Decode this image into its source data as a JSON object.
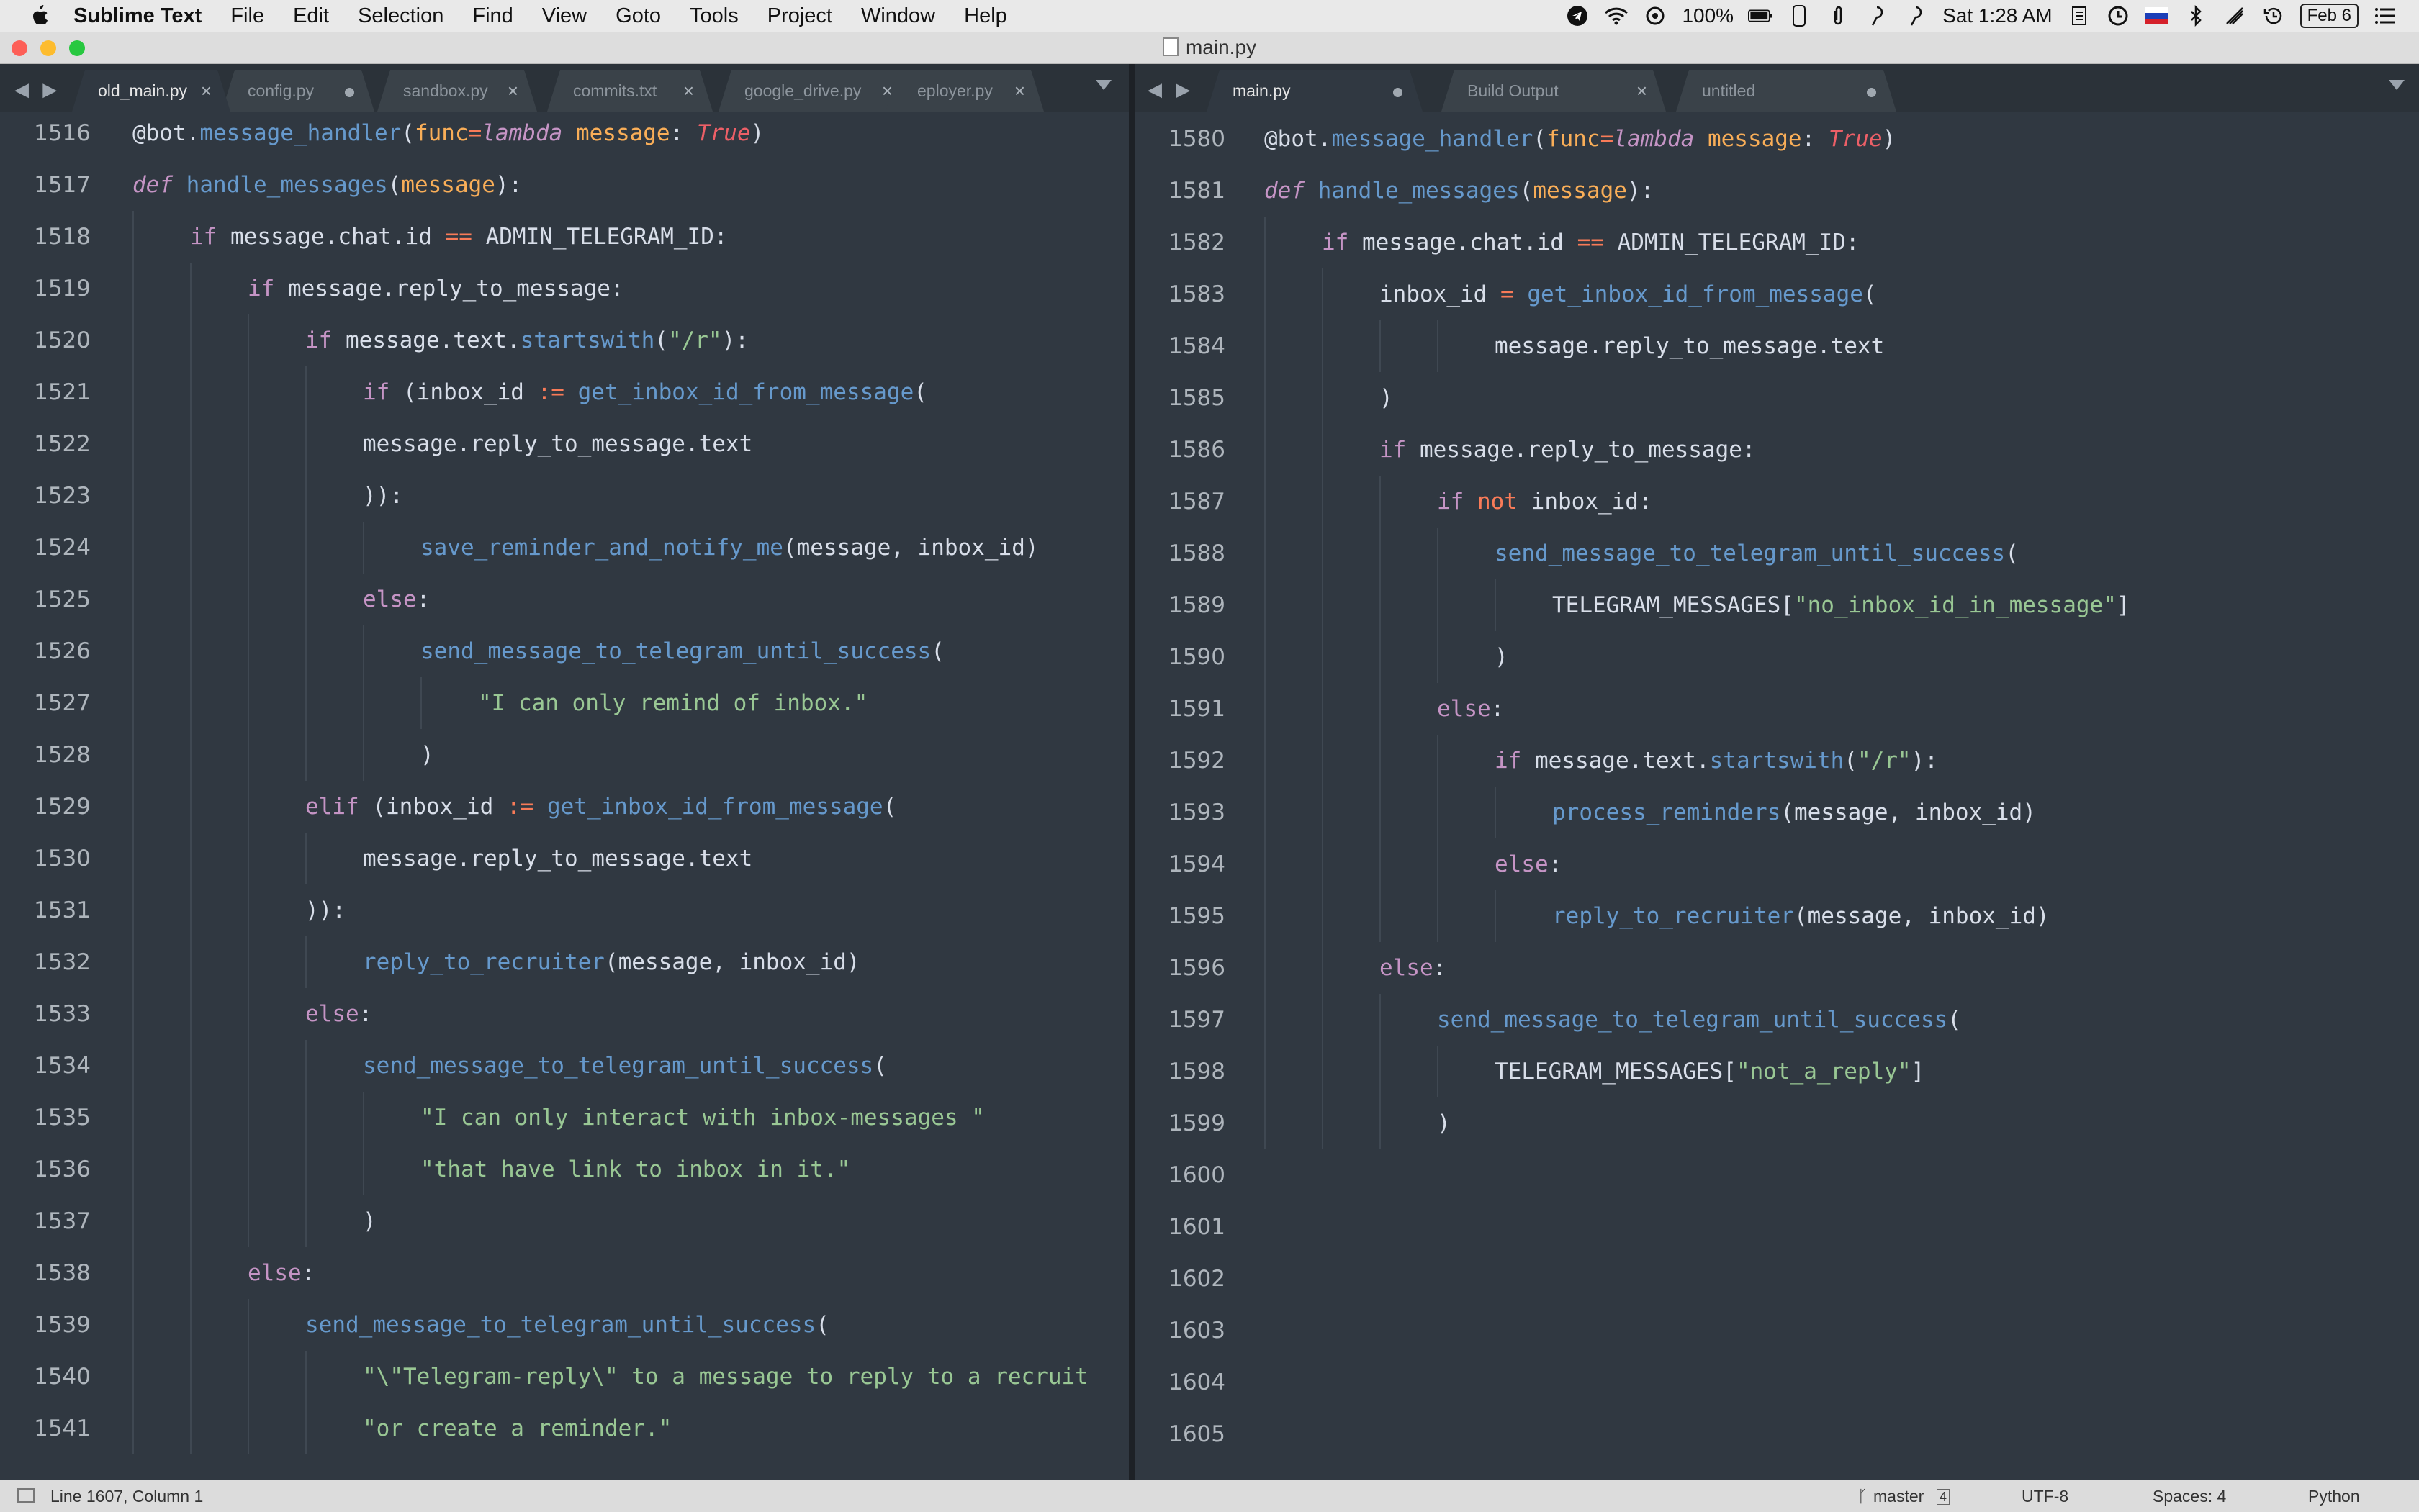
{
  "menubar": {
    "app": "Sublime Text",
    "items": [
      "File",
      "Edit",
      "Selection",
      "Find",
      "View",
      "Goto",
      "Tools",
      "Project",
      "Window",
      "Help"
    ],
    "battery": "100%",
    "clock": "Sat 1:28 AM",
    "date_badge": "Feb 6"
  },
  "window": {
    "title": "main.py"
  },
  "left_pane": {
    "tabs": [
      {
        "label": "old_main.py",
        "active": true,
        "marker": "close"
      },
      {
        "label": "config.py",
        "active": false,
        "marker": "dot"
      },
      {
        "label": "sandbox.py",
        "active": false,
        "marker": "close"
      },
      {
        "label": "commits.txt",
        "active": false,
        "marker": "close"
      },
      {
        "label": "google_drive.py",
        "active": false,
        "marker": "close"
      },
      {
        "label": "eployer.py",
        "active": false,
        "marker": "close"
      }
    ],
    "lines": [
      {
        "n": "1516",
        "indent": 0,
        "tokens": [
          [
            "pl",
            "@bot."
          ],
          [
            "fn",
            "message_handler"
          ],
          [
            "pl",
            "("
          ],
          [
            "param",
            "func"
          ],
          [
            "op",
            "="
          ],
          [
            "k",
            "lambda"
          ],
          [
            "pl",
            " "
          ],
          [
            "param",
            "message"
          ],
          [
            "pl",
            ": "
          ],
          [
            "bool",
            "True"
          ],
          [
            "pl",
            ")"
          ]
        ]
      },
      {
        "n": "1517",
        "indent": 0,
        "tokens": [
          [
            "k",
            "def"
          ],
          [
            "pl",
            " "
          ],
          [
            "fn",
            "handle_messages"
          ],
          [
            "pl",
            "("
          ],
          [
            "param",
            "message"
          ],
          [
            "pl",
            "):"
          ]
        ]
      },
      {
        "n": "1518",
        "indent": 1,
        "tokens": [
          [
            "k2",
            "if"
          ],
          [
            "pl",
            " message.chat.id "
          ],
          [
            "op",
            "=="
          ],
          [
            "pl",
            " ADMIN_TELEGRAM_ID:"
          ]
        ]
      },
      {
        "n": "1519",
        "indent": 2,
        "tokens": [
          [
            "k2",
            "if"
          ],
          [
            "pl",
            " message.reply_to_message:"
          ]
        ]
      },
      {
        "n": "1520",
        "indent": 3,
        "tokens": [
          [
            "k2",
            "if"
          ],
          [
            "pl",
            " message.text."
          ],
          [
            "fn",
            "startswith"
          ],
          [
            "pl",
            "("
          ],
          [
            "str",
            "\"/r\""
          ],
          [
            "pl",
            "):"
          ]
        ]
      },
      {
        "n": "1521",
        "indent": 4,
        "tokens": [
          [
            "k2",
            "if"
          ],
          [
            "pl",
            " (inbox_id "
          ],
          [
            "op",
            ":="
          ],
          [
            "pl",
            " "
          ],
          [
            "fn",
            "get_inbox_id_from_message"
          ],
          [
            "pl",
            "("
          ]
        ]
      },
      {
        "n": "1522",
        "indent": 4,
        "tokens": [
          [
            "pl",
            "message.reply_to_message.text"
          ]
        ]
      },
      {
        "n": "1523",
        "indent": 4,
        "tokens": [
          [
            "pl",
            "))"
          ],
          [
            "pl",
            ":"
          ]
        ]
      },
      {
        "n": "1524",
        "indent": 5,
        "tokens": [
          [
            "fn",
            "save_reminder_and_notify_me"
          ],
          [
            "pl",
            "(message, inbox_id)"
          ]
        ]
      },
      {
        "n": "1525",
        "indent": 4,
        "tokens": [
          [
            "k2",
            "else"
          ],
          [
            "pl",
            ":"
          ]
        ]
      },
      {
        "n": "1526",
        "indent": 5,
        "tokens": [
          [
            "fn",
            "send_message_to_telegram_until_success"
          ],
          [
            "pl",
            "("
          ]
        ]
      },
      {
        "n": "1527",
        "indent": 6,
        "tokens": [
          [
            "str",
            "\"I can only remind of inbox.\""
          ]
        ]
      },
      {
        "n": "1528",
        "indent": 5,
        "tokens": [
          [
            "pl",
            ")"
          ]
        ]
      },
      {
        "n": "1529",
        "indent": 3,
        "tokens": [
          [
            "k2",
            "elif"
          ],
          [
            "pl",
            " (inbox_id "
          ],
          [
            "op",
            ":="
          ],
          [
            "pl",
            " "
          ],
          [
            "fn",
            "get_inbox_id_from_message"
          ],
          [
            "pl",
            "("
          ]
        ]
      },
      {
        "n": "1530",
        "indent": 4,
        "tokens": [
          [
            "pl",
            "message.reply_to_message.text"
          ]
        ]
      },
      {
        "n": "1531",
        "indent": 3,
        "tokens": [
          [
            "pl",
            "))"
          ],
          [
            "pl",
            ":"
          ]
        ]
      },
      {
        "n": "1532",
        "indent": 4,
        "tokens": [
          [
            "fn",
            "reply_to_recruiter"
          ],
          [
            "pl",
            "(message, inbox_id)"
          ]
        ]
      },
      {
        "n": "1533",
        "indent": 3,
        "tokens": [
          [
            "k2",
            "else"
          ],
          [
            "pl",
            ":"
          ]
        ]
      },
      {
        "n": "1534",
        "indent": 4,
        "tokens": [
          [
            "fn",
            "send_message_to_telegram_until_success"
          ],
          [
            "pl",
            "("
          ]
        ]
      },
      {
        "n": "1535",
        "indent": 5,
        "tokens": [
          [
            "str",
            "\"I can only interact with inbox-messages \""
          ]
        ]
      },
      {
        "n": "1536",
        "indent": 5,
        "tokens": [
          [
            "str",
            "\"that have link to inbox in it.\""
          ]
        ]
      },
      {
        "n": "1537",
        "indent": 4,
        "tokens": [
          [
            "pl",
            ")"
          ]
        ]
      },
      {
        "n": "1538",
        "indent": 2,
        "tokens": [
          [
            "k2",
            "else"
          ],
          [
            "pl",
            ":"
          ]
        ]
      },
      {
        "n": "1539",
        "indent": 3,
        "tokens": [
          [
            "fn",
            "send_message_to_telegram_until_success"
          ],
          [
            "pl",
            "("
          ]
        ]
      },
      {
        "n": "1540",
        "indent": 4,
        "tokens": [
          [
            "str",
            "\"\\\"Telegram-reply\\\" to a message to reply to a recruit"
          ]
        ]
      },
      {
        "n": "1541",
        "indent": 4,
        "tokens": [
          [
            "str",
            "\"or create a reminder.\""
          ]
        ]
      }
    ]
  },
  "right_pane": {
    "tabs": [
      {
        "label": "main.py",
        "active": true,
        "marker": "dot"
      },
      {
        "label": "Build Output",
        "active": false,
        "marker": "close"
      },
      {
        "label": "untitled",
        "active": false,
        "marker": "dot"
      }
    ],
    "lines": [
      {
        "n": "1580",
        "indent": 0,
        "tokens": [
          [
            "pl",
            "@bot."
          ],
          [
            "fn",
            "message_handler"
          ],
          [
            "pl",
            "("
          ],
          [
            "param",
            "func"
          ],
          [
            "op",
            "="
          ],
          [
            "k",
            "lambda"
          ],
          [
            "pl",
            " "
          ],
          [
            "param",
            "message"
          ],
          [
            "pl",
            ": "
          ],
          [
            "bool",
            "True"
          ],
          [
            "pl",
            ")"
          ]
        ]
      },
      {
        "n": "1581",
        "indent": 0,
        "tokens": [
          [
            "k",
            "def"
          ],
          [
            "pl",
            " "
          ],
          [
            "fn",
            "handle_messages"
          ],
          [
            "pl",
            "("
          ],
          [
            "param",
            "message"
          ],
          [
            "pl",
            "):"
          ]
        ]
      },
      {
        "n": "1582",
        "indent": 1,
        "tokens": [
          [
            "k2",
            "if"
          ],
          [
            "pl",
            " message.chat.id "
          ],
          [
            "op",
            "=="
          ],
          [
            "pl",
            " ADMIN_TELEGRAM_ID:"
          ]
        ]
      },
      {
        "n": "1583",
        "indent": 2,
        "tokens": [
          [
            "pl",
            "inbox_id "
          ],
          [
            "op",
            "="
          ],
          [
            "pl",
            " "
          ],
          [
            "fn",
            "get_inbox_id_from_message"
          ],
          [
            "pl",
            "("
          ]
        ]
      },
      {
        "n": "1584",
        "indent": 4,
        "tokens": [
          [
            "pl",
            "message.reply_to_message.text"
          ]
        ]
      },
      {
        "n": "1585",
        "indent": 2,
        "tokens": [
          [
            "pl",
            ")"
          ]
        ]
      },
      {
        "n": "1586",
        "indent": 2,
        "tokens": [
          [
            "k2",
            "if"
          ],
          [
            "pl",
            " message.reply_to_message:"
          ]
        ]
      },
      {
        "n": "1587",
        "indent": 3,
        "tokens": [
          [
            "k2",
            "if"
          ],
          [
            "pl",
            " "
          ],
          [
            "op",
            "not"
          ],
          [
            "pl",
            " inbox_id:"
          ]
        ]
      },
      {
        "n": "1588",
        "indent": 4,
        "tokens": [
          [
            "fn",
            "send_message_to_telegram_until_success"
          ],
          [
            "pl",
            "("
          ]
        ]
      },
      {
        "n": "1589",
        "indent": 5,
        "tokens": [
          [
            "pl",
            "TELEGRAM_MESSAGES["
          ],
          [
            "str",
            "\"no_inbox_id_in_message\""
          ],
          [
            "pl",
            "]"
          ]
        ]
      },
      {
        "n": "1590",
        "indent": 4,
        "tokens": [
          [
            "pl",
            ")"
          ]
        ]
      },
      {
        "n": "1591",
        "indent": 3,
        "tokens": [
          [
            "k2",
            "else"
          ],
          [
            "pl",
            ":"
          ]
        ]
      },
      {
        "n": "1592",
        "indent": 4,
        "tokens": [
          [
            "k2",
            "if"
          ],
          [
            "pl",
            " message.text."
          ],
          [
            "fn",
            "startswith"
          ],
          [
            "pl",
            "("
          ],
          [
            "str",
            "\"/r\""
          ],
          [
            "pl",
            "):"
          ]
        ]
      },
      {
        "n": "1593",
        "indent": 5,
        "tokens": [
          [
            "fn",
            "process_reminders"
          ],
          [
            "pl",
            "(message, inbox_id)"
          ]
        ]
      },
      {
        "n": "1594",
        "indent": 4,
        "tokens": [
          [
            "k2",
            "else"
          ],
          [
            "pl",
            ":"
          ]
        ]
      },
      {
        "n": "1595",
        "indent": 5,
        "tokens": [
          [
            "fn",
            "reply_to_recruiter"
          ],
          [
            "pl",
            "(message, inbox_id)"
          ]
        ]
      },
      {
        "n": "1596",
        "indent": 2,
        "tokens": [
          [
            "k2",
            "else"
          ],
          [
            "pl",
            ":"
          ]
        ]
      },
      {
        "n": "1597",
        "indent": 3,
        "tokens": [
          [
            "fn",
            "send_message_to_telegram_until_success"
          ],
          [
            "pl",
            "("
          ]
        ]
      },
      {
        "n": "1598",
        "indent": 4,
        "tokens": [
          [
            "pl",
            "TELEGRAM_MESSAGES["
          ],
          [
            "str",
            "\"not_a_reply\""
          ],
          [
            "pl",
            "]"
          ]
        ]
      },
      {
        "n": "1599",
        "indent": 3,
        "tokens": [
          [
            "pl",
            ")"
          ]
        ]
      },
      {
        "n": "1600",
        "indent": 0,
        "tokens": []
      },
      {
        "n": "1601",
        "indent": 0,
        "tokens": []
      },
      {
        "n": "1602",
        "indent": 0,
        "tokens": []
      },
      {
        "n": "1603",
        "indent": 0,
        "tokens": []
      },
      {
        "n": "1604",
        "indent": 0,
        "tokens": []
      },
      {
        "n": "1605",
        "indent": 0,
        "tokens": []
      }
    ]
  },
  "statusbar": {
    "position": "Line 1607, Column 1",
    "branch": "master",
    "branch_count": "4",
    "encoding": "UTF-8",
    "indentation": "Spaces: 4",
    "syntax": "Python"
  },
  "colors": {
    "keyword": "#c594c5",
    "function": "#6699cc",
    "string": "#99c794",
    "operator": "#f97b58",
    "boolean": "#ec5f67",
    "parameter": "#f9ae58",
    "background": "#303841"
  }
}
